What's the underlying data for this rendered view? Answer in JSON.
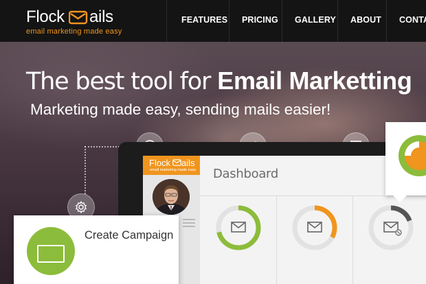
{
  "brand": {
    "name_part1": "Flock",
    "name_part2": "ails",
    "tagline": "email marketing made easy",
    "accent_color": "#f0951e",
    "logo_icon": "envelope-icon"
  },
  "nav": {
    "items": [
      {
        "label": "FEATURES"
      },
      {
        "label": "PRICING"
      },
      {
        "label": "GALLERY"
      },
      {
        "label": "ABOUT"
      },
      {
        "label": "CONTACT"
      }
    ]
  },
  "hero": {
    "title_light": "The best tool for",
    "title_bold": "Email Marketting",
    "subtitle": "Marketing made easy, sending mails easier!",
    "icons": [
      "lifebuoy-icon",
      "megaphone-icon",
      "layout-icon",
      "gear-icon"
    ]
  },
  "dashboard": {
    "brand_part1": "Flock",
    "brand_part2": "ails",
    "tagline": "email marketing made easy",
    "title": "Dashboard",
    "ring_colors": [
      "#8cbc3b",
      "#f0951e",
      "#555555"
    ]
  },
  "cards": {
    "create_campaign": "Create Campaign",
    "accent_green": "#8cbc3b"
  }
}
